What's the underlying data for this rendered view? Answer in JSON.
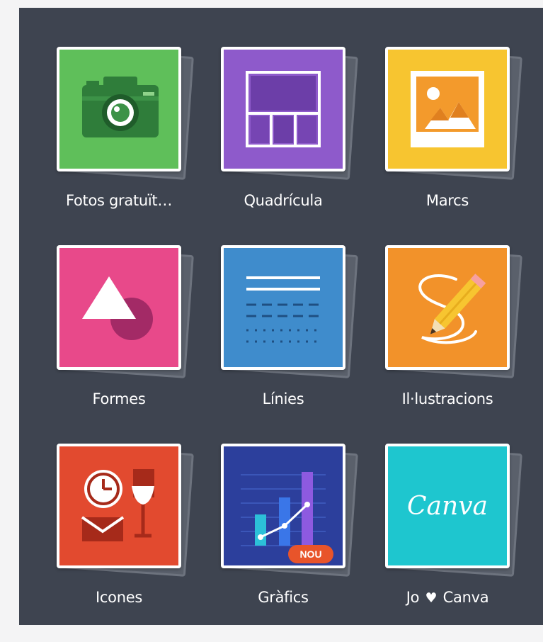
{
  "panel": {
    "items": [
      {
        "id": "fotos",
        "label": "Fotos gratuït…",
        "icon": "camera-icon",
        "color": "#5fbf5a"
      },
      {
        "id": "quadricula",
        "label": "Quadrícula",
        "icon": "grid-layout-icon",
        "color": "#8e5acb"
      },
      {
        "id": "marcs",
        "label": "Marcs",
        "icon": "picture-frame-icon",
        "color": "#f7c530"
      },
      {
        "id": "formes",
        "label": "Formes",
        "icon": "shapes-icon",
        "color": "#e8498a"
      },
      {
        "id": "linies",
        "label": "Línies",
        "icon": "lines-icon",
        "color": "#3f8ccc"
      },
      {
        "id": "illustracions",
        "label": "Il·lustracions",
        "icon": "pencil-drawing-icon",
        "color": "#f2922a"
      },
      {
        "id": "icones",
        "label": "Icones",
        "icon": "clock-envelope-glass-icon",
        "color": "#e24a2f"
      },
      {
        "id": "grafics",
        "label": "Gràfics",
        "icon": "chart-icon",
        "color": "#2c3f9c",
        "badge": "NOU"
      },
      {
        "id": "jocanva",
        "label_prefix": "Jo",
        "label_suffix": "Canva",
        "heart": "♥",
        "icon": "canva-logo-icon",
        "logo_text": "Canva",
        "color": "#1ec6cf"
      }
    ]
  }
}
